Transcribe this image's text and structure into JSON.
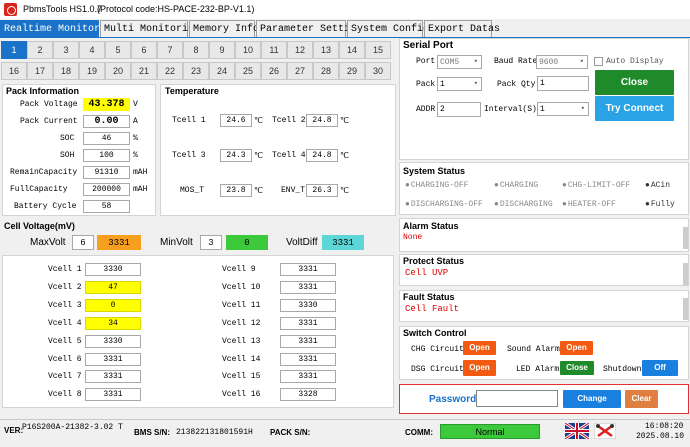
{
  "app": {
    "title": "PbmsTools HS1.0.7",
    "protocol": "(Protocol code:HS-PACE-232-BP-V1.1)"
  },
  "tabs": [
    "Realtime Monitoring",
    "Multi Monitoring",
    "Memory Info.",
    "Parameter Setting",
    "System Config.",
    "Export Datas"
  ],
  "cell_numbers": [
    "1",
    "2",
    "3",
    "4",
    "5",
    "6",
    "7",
    "8",
    "9",
    "10",
    "11",
    "12",
    "13",
    "14",
    "15",
    "16",
    "17",
    "18",
    "19",
    "20",
    "21",
    "22",
    "23",
    "24",
    "25",
    "26",
    "27",
    "28",
    "29",
    "30"
  ],
  "pack_info": {
    "title": "Pack Information",
    "rows": [
      {
        "label": "Pack Voltage",
        "value": "43.378",
        "unit": "V"
      },
      {
        "label": "Pack Current",
        "value": "0.00",
        "unit": "A"
      },
      {
        "label": "SOC",
        "value": "46",
        "unit": "%"
      },
      {
        "label": "SOH",
        "value": "100",
        "unit": "%"
      },
      {
        "label": "RemainCapacity",
        "value": "91310",
        "unit": "mAH"
      },
      {
        "label": "FullCapacity",
        "value": "200000",
        "unit": "mAH"
      },
      {
        "label": "Battery Cycle",
        "value": "58",
        "unit": ""
      }
    ]
  },
  "temperature": {
    "title": "Temperature",
    "items": [
      {
        "label": "Tcell 1",
        "value": "24.6",
        "unit": "℃"
      },
      {
        "label": "Tcell 2",
        "value": "24.8",
        "unit": "℃"
      },
      {
        "label": "Tcell 3",
        "value": "24.3",
        "unit": "℃"
      },
      {
        "label": "Tcell 4",
        "value": "24.8",
        "unit": "℃"
      },
      {
        "label": "MOS_T",
        "value": "23.8",
        "unit": "℃"
      },
      {
        "label": "ENV_T",
        "value": "26.3",
        "unit": "℃"
      }
    ]
  },
  "cell_voltage": {
    "title": "Cell Voltage(mV)",
    "max_label": "MaxVolt",
    "max_cell": "6",
    "max_value": "3331",
    "min_label": "MinVolt",
    "min_cell": "3",
    "min_value": "0",
    "diff_label": "VoltDiff",
    "diff_value": "3331",
    "left": [
      {
        "label": "Vcell 1",
        "value": "3330",
        "hl": false
      },
      {
        "label": "Vcell 2",
        "value": "47",
        "hl": true
      },
      {
        "label": "Vcell 3",
        "value": "0",
        "hl": true
      },
      {
        "label": "Vcell 4",
        "value": "34",
        "hl": true
      },
      {
        "label": "Vcell 5",
        "value": "3330",
        "hl": false
      },
      {
        "label": "Vcell 6",
        "value": "3331",
        "hl": false
      },
      {
        "label": "Vcell 7",
        "value": "3331",
        "hl": false
      },
      {
        "label": "Vcell 8",
        "value": "3331",
        "hl": false
      }
    ],
    "right": [
      {
        "label": "Vcell 9",
        "value": "3331"
      },
      {
        "label": "Vcell 10",
        "value": "3331"
      },
      {
        "label": "Vcell 11",
        "value": "3330"
      },
      {
        "label": "Vcell 12",
        "value": "3331"
      },
      {
        "label": "Vcell 13",
        "value": "3331"
      },
      {
        "label": "Vcell 14",
        "value": "3331"
      },
      {
        "label": "Vcell 15",
        "value": "3331"
      },
      {
        "label": "Vcell 16",
        "value": "3328"
      }
    ]
  },
  "serial_port": {
    "title": "Serial Port",
    "port_label": "Port",
    "port_value": "COM5",
    "baud_label": "Baud Rate",
    "baud_value": "9600",
    "auto_display": "Auto Display",
    "pack_label": "Pack",
    "pack_value": "1",
    "pack_qty_label": "Pack Qty",
    "pack_qty_value": "1",
    "addr_label": "ADDR",
    "addr_value": "2",
    "interval_label": "Interval(S)",
    "interval_value": "1",
    "close_btn": "Close",
    "try_btn": "Try Connect"
  },
  "system_status": {
    "title": "System Status",
    "items": [
      "CHARGING-OFF",
      "CHARGING",
      "CHG-LIMIT-OFF",
      "ACin",
      "DISCHARGING-OFF",
      "DISCHARGING",
      "HEATER-OFF",
      "Fully"
    ]
  },
  "alarm_status": {
    "title": "Alarm Status",
    "value": "None"
  },
  "protect_status": {
    "title": "Protect Status",
    "value": "Cell UVP"
  },
  "fault_status": {
    "title": "Fault Status",
    "value": "Cell Fault"
  },
  "switch_control": {
    "title": "Switch Control",
    "chg_label": "CHG Circuit",
    "chg_btn": "Open",
    "sound_label": "Sound Alarm",
    "sound_btn": "Open",
    "dsg_label": "DSG Circuit",
    "dsg_btn": "Open",
    "led_label": "LED Alarm",
    "led_btn": "Close",
    "shutdown_label": "Shutdown",
    "shutdown_btn": "Off"
  },
  "password": {
    "label": "Password",
    "change_btn": "Change",
    "clear_btn": "Clear"
  },
  "footer": {
    "ver_label": "VER:",
    "ver_value": "P16S200A-21382-3.02 T",
    "bms_label": "BMS S/N:",
    "bms_value": "213822131801591H",
    "pack_label": "PACK S/N:",
    "comm_label": "COMM:",
    "comm_value": "Normal",
    "time": "16:08:20",
    "date": "2025.08.10"
  },
  "colors": {
    "accent": "#1a73c8",
    "green": "#1e8a2a",
    "orange": "#f25a12",
    "yellow": "#ffff00",
    "red": "#e00000"
  }
}
